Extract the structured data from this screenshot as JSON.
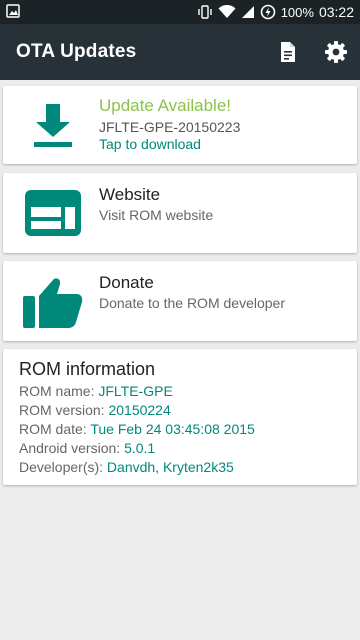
{
  "status_bar": {
    "left_icon": "image-notification-icon",
    "battery": "100%",
    "time": "03:22",
    "icons": [
      "vibrate-icon",
      "wifi-icon",
      "signal-icon",
      "data-saver-icon"
    ]
  },
  "app_bar": {
    "title": "OTA Updates",
    "actions": [
      "changelog-icon",
      "settings-icon"
    ]
  },
  "cards": {
    "update": {
      "title": "Update Available!",
      "version": "JFLTE-GPE-20150223",
      "action": "Tap to download"
    },
    "website": {
      "title": "Website",
      "subtitle": "Visit ROM website"
    },
    "donate": {
      "title": "Donate",
      "subtitle": "Donate to the ROM developer"
    }
  },
  "rom_info": {
    "title": "ROM information",
    "rows": [
      {
        "label": "ROM name: ",
        "value": "JFLTE-GPE"
      },
      {
        "label": "ROM version: ",
        "value": "20150224"
      },
      {
        "label": "ROM date: ",
        "value": "Tue Feb 24 03:45:08 2015"
      },
      {
        "label": "Android version: ",
        "value": "5.0.1"
      },
      {
        "label": "Developer(s): ",
        "value": "Danvdh, Kryten2k35"
      }
    ]
  },
  "colors": {
    "accent": "#00897b",
    "update_green": "#8bc34a",
    "toolbar": "#263238",
    "status_bar": "#1b2327"
  }
}
